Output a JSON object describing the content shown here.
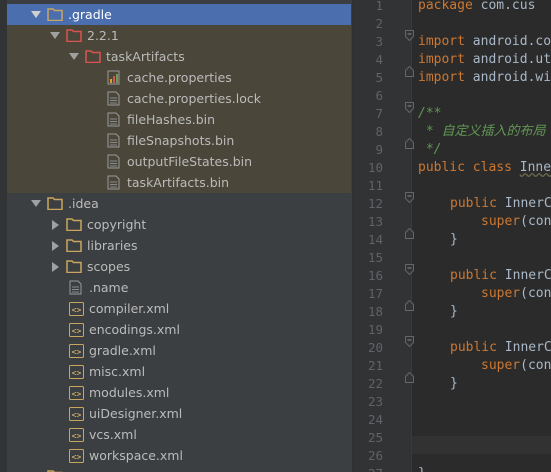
{
  "project_tree": {
    "items": [
      {
        "label": ".gradle",
        "type": "folder",
        "expanded": true,
        "selected": true
      },
      {
        "label": "2.2.1",
        "type": "folder-red",
        "expanded": true
      },
      {
        "label": "taskArtifacts",
        "type": "folder-red",
        "expanded": true
      },
      {
        "label": "cache.properties",
        "type": "properties-file"
      },
      {
        "label": "cache.properties.lock",
        "type": "lock-file"
      },
      {
        "label": "fileHashes.bin",
        "type": "text-file"
      },
      {
        "label": "fileSnapshots.bin",
        "type": "text-file"
      },
      {
        "label": "outputFileStates.bin",
        "type": "text-file"
      },
      {
        "label": "taskArtifacts.bin",
        "type": "text-file"
      },
      {
        "label": ".idea",
        "type": "folder",
        "expanded": true
      },
      {
        "label": "copyright",
        "type": "folder",
        "expanded": false
      },
      {
        "label": "libraries",
        "type": "folder",
        "expanded": false
      },
      {
        "label": "scopes",
        "type": "folder",
        "expanded": false
      },
      {
        "label": ".name",
        "type": "text-file"
      },
      {
        "label": "compiler.xml",
        "type": "xml-file"
      },
      {
        "label": "encodings.xml",
        "type": "xml-file"
      },
      {
        "label": "gradle.xml",
        "type": "xml-file"
      },
      {
        "label": "misc.xml",
        "type": "xml-file"
      },
      {
        "label": "modules.xml",
        "type": "xml-file"
      },
      {
        "label": "uiDesigner.xml",
        "type": "xml-file"
      },
      {
        "label": "vcs.xml",
        "type": "xml-file"
      },
      {
        "label": "workspace.xml",
        "type": "xml-file"
      }
    ]
  },
  "editor": {
    "line_numbers": [
      "1",
      "2",
      "3",
      "4",
      "5",
      "6",
      "7",
      "8",
      "9",
      "10",
      "11",
      "12",
      "13",
      "14",
      "15",
      "16",
      "17",
      "18",
      "19",
      "20",
      "21",
      "22",
      "23",
      "24",
      "25",
      "26",
      "27"
    ],
    "lines": {
      "l1_kw": "package",
      "l1_rest": " com.cus",
      "l3_kw": "import",
      "l3_rest": " android.co",
      "l4_kw": "import",
      "l4_rest": " android.ut",
      "l5_kw": "import",
      "l5_rest": " android.wi",
      "l7": "/**",
      "l8": " * 自定义插入的布局",
      "l9": " */",
      "l10_kw": "public class",
      "l10_rest": "Inne",
      "l12_kw": "public",
      "l12_rest": " InnerC",
      "l13_kw": "super",
      "l13_rest": "(con",
      "l14": "}",
      "l16_kw": "public",
      "l16_rest": " InnerC",
      "l17_kw": "super",
      "l17_rest": "(con",
      "l18": "}",
      "l20_kw": "public",
      "l20_rest": " InnerC",
      "l21_kw": "super",
      "l21_rest": "(con",
      "l22": "}",
      "l27": "}"
    }
  },
  "colors": {
    "background": "#2b2b2b",
    "tree_background": "#3c3f41",
    "selection": "#4b6eaf",
    "folder": "#c9a65f",
    "folder_red": "#d9534f",
    "keyword": "#cc7832",
    "doc_comment": "#629755"
  }
}
